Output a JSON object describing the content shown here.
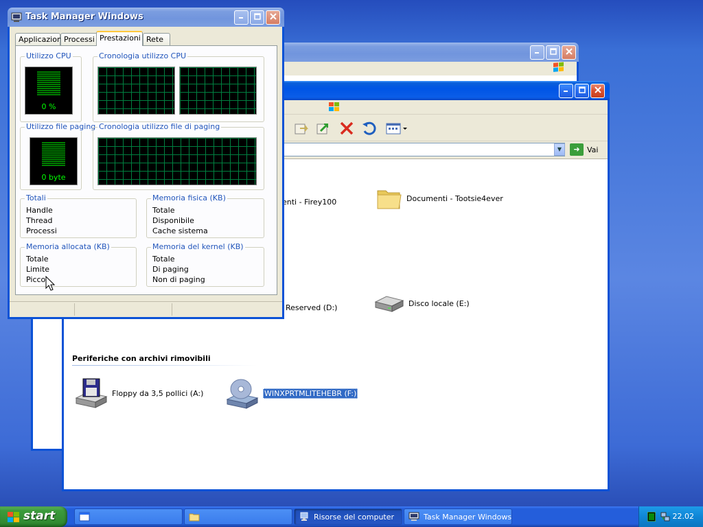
{
  "task_manager": {
    "title": "Task Manager Windows",
    "tabs": [
      {
        "label": "Applicazioni"
      },
      {
        "label": "Processi"
      },
      {
        "label": "Prestazioni"
      },
      {
        "label": "Rete"
      }
    ],
    "cpu_usage": {
      "title": "Utilizzo CPU",
      "value": "0 %"
    },
    "cpu_history": {
      "title": "Cronologia utilizzo CPU"
    },
    "pagefile_usage": {
      "title": "Utilizzo file paging",
      "value": "0 byte"
    },
    "pagefile_history": {
      "title": "Cronologia utilizzo file di paging"
    },
    "totals": {
      "title": "Totali",
      "rows": [
        "Handle",
        "Thread",
        "Processi"
      ]
    },
    "physical_memory": {
      "title": "Memoria fisica (KB)",
      "rows": [
        "Totale",
        "Disponibile",
        "Cache sistema"
      ]
    },
    "commit_charge": {
      "title": "Memoria allocata (KB)",
      "rows": [
        "Totale",
        "Limite",
        "Picco"
      ]
    },
    "kernel_memory": {
      "title": "Memoria del kernel (KB)",
      "rows": [
        "Totale",
        "Di paging",
        "Non di paging"
      ]
    }
  },
  "explorer": {
    "go_label": "Vai",
    "items": [
      {
        "label": "enti - Firey100",
        "icon": "folder-icon"
      },
      {
        "label": "Documenti - Tootsie4ever",
        "icon": "folder-icon"
      },
      {
        "label": "Reserved (D:)",
        "icon": "drive-icon"
      },
      {
        "label": "Disco locale (E:)",
        "icon": "hard-drive-icon"
      }
    ],
    "removable_section": "Periferiche con archivi rimovibili",
    "removable_items": [
      {
        "label": "Floppy da 3,5 pollici (A:)",
        "icon": "floppy-drive-icon"
      },
      {
        "label": "WINXPRTMLITEHEBR (F:)",
        "icon": "cd-drive-icon",
        "selected": true
      }
    ]
  },
  "taskbar": {
    "start_label": "start",
    "buttons": [
      {
        "label": ""
      },
      {
        "label": ""
      },
      {
        "label": "Risorse del computer"
      },
      {
        "label": "Task Manager Windows"
      }
    ],
    "clock": "22.02"
  },
  "colors": {
    "xp_blue_title": "#0055e5",
    "selection": "#316ac5",
    "group_title": "#2155bb",
    "graph_grid": "#008040"
  }
}
